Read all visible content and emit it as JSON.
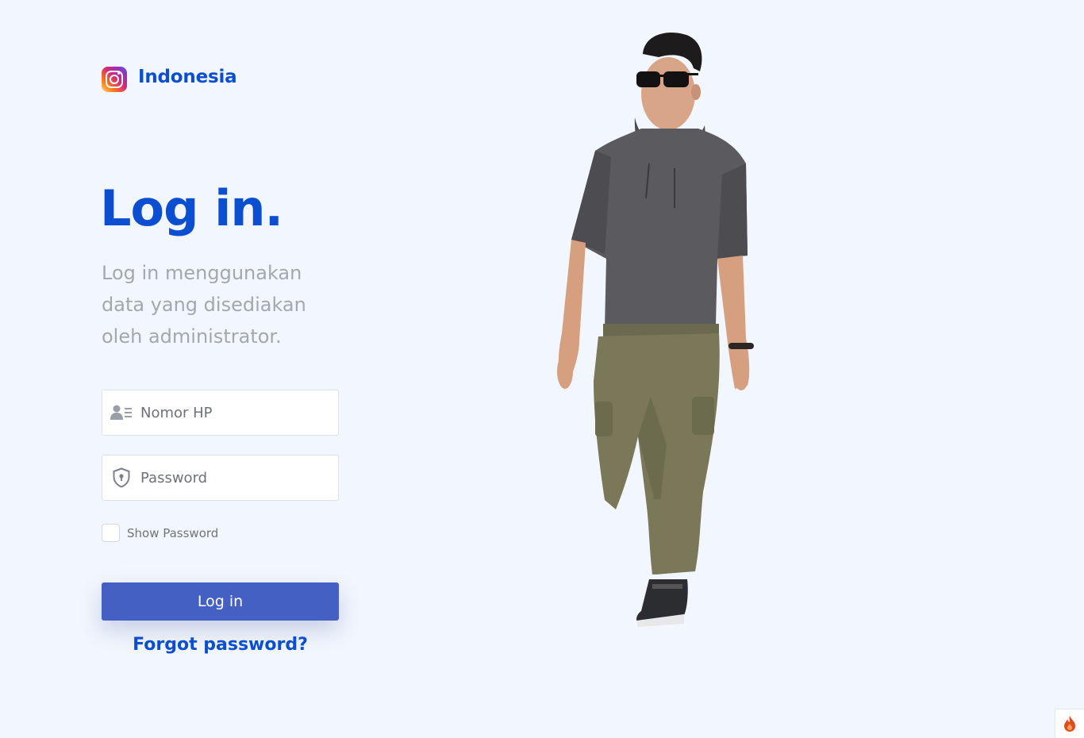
{
  "brand": {
    "name": "Indonesia",
    "logo": "instagram-logo"
  },
  "heading": {
    "title": "Log in.",
    "subtitle": "Log in menggunakan data yang disediakan oleh administrator."
  },
  "form": {
    "phone": {
      "placeholder": "Nomor HP",
      "value": "",
      "icon": "user-id-icon"
    },
    "password": {
      "placeholder": "Password",
      "value": "",
      "icon": "shield-lock-icon"
    },
    "show_password": {
      "label": "Show Password",
      "checked": false
    },
    "submit_label": "Log in",
    "forgot_label": "Forgot password?"
  },
  "hero": {
    "description": "man-walking-photo"
  },
  "corner_badge": {
    "icon": "flame-icon"
  },
  "colors": {
    "background": "#f2f6fe",
    "primary": "#0b4fd0",
    "button": "#4360c2",
    "muted_text": "#a3a7b2"
  }
}
